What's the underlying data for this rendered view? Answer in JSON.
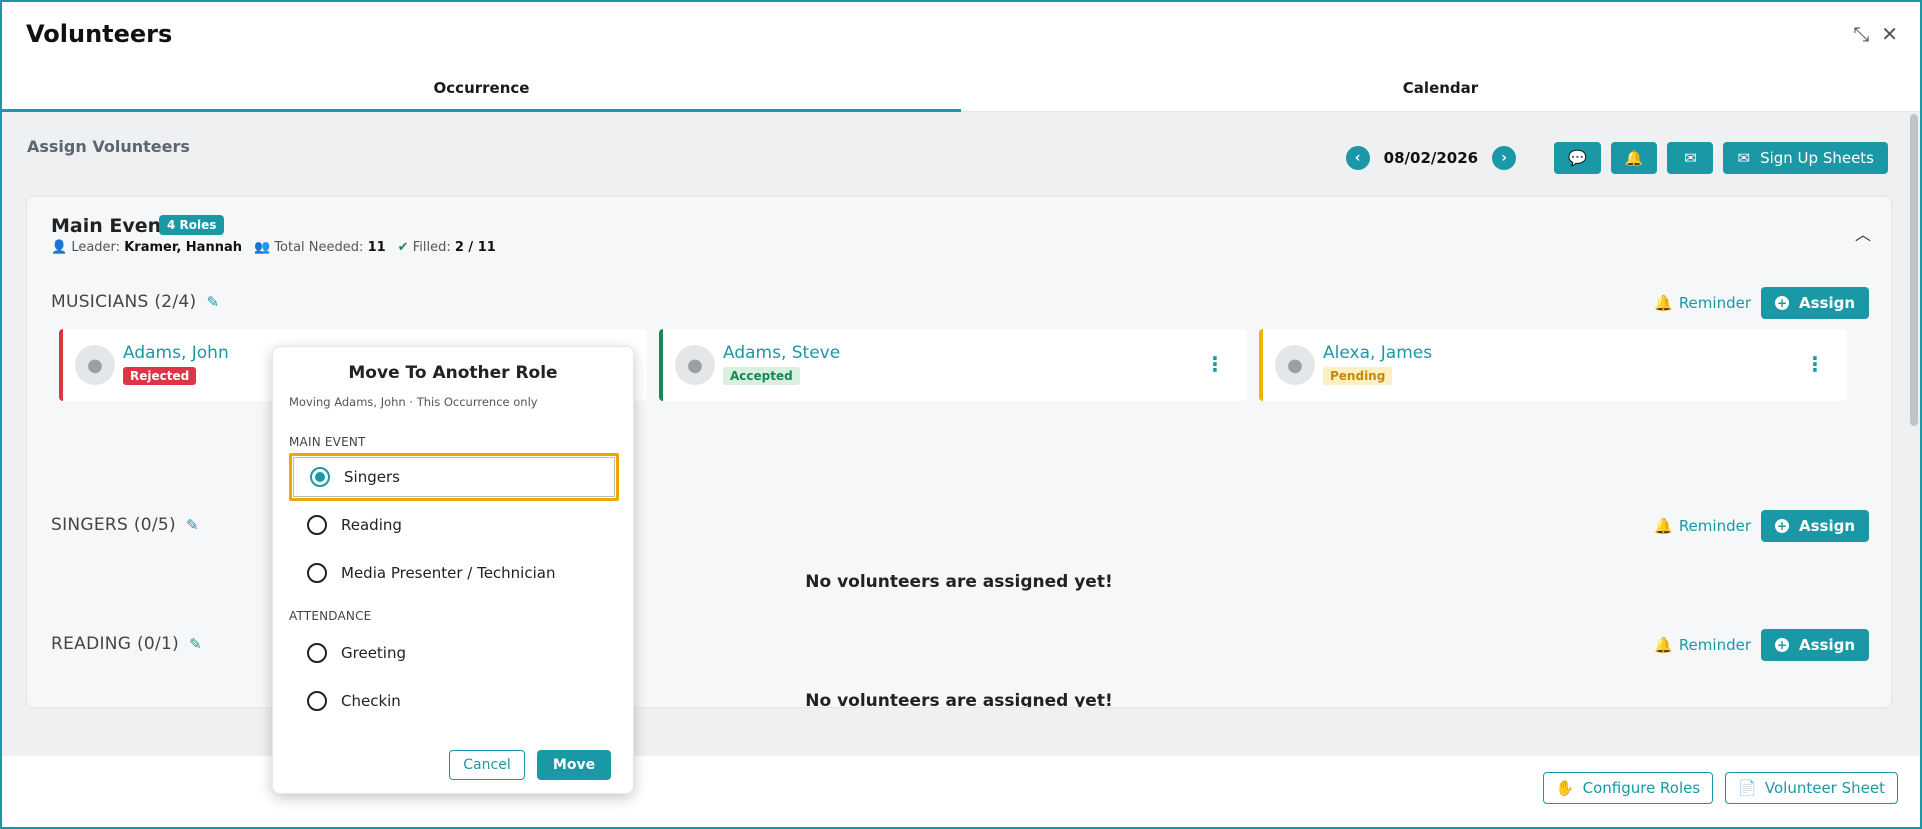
{
  "window": {
    "title": "Volunteers"
  },
  "tabs": [
    {
      "label": "Occurrence",
      "active": true
    },
    {
      "label": "Calendar",
      "active": false
    }
  ],
  "section": {
    "title": "Assign Volunteers"
  },
  "toolbar": {
    "date": "08/02/2026",
    "sign_up_label": "Sign Up Sheets"
  },
  "event": {
    "name": "Main Event",
    "roles_badge": "4 Roles",
    "leader_label": "Leader:",
    "leader": "Kramer, Hannah",
    "total_label": "Total Needed:",
    "total": "11",
    "filled_label": "Filled:",
    "filled": "2 / 11"
  },
  "roles": [
    {
      "heading": "MUSICIANS (2/4)",
      "reminder": "Reminder",
      "assign": "Assign",
      "volunteers": [
        {
          "name": "Adams, John",
          "status": "Rejected"
        },
        {
          "name": "Adams, Steve",
          "status": "Accepted"
        },
        {
          "name": "Alexa, James",
          "status": "Pending"
        }
      ]
    },
    {
      "heading": "SINGERS (0/5)",
      "reminder": "Reminder",
      "assign": "Assign",
      "empty": "No volunteers are assigned yet!"
    },
    {
      "heading": "READING (0/1)",
      "reminder": "Reminder",
      "assign": "Assign",
      "empty": "No volunteers are assigned yet!"
    }
  ],
  "footer": {
    "configure": "Configure Roles",
    "sheet": "Volunteer Sheet"
  },
  "popover": {
    "title": "Move To Another Role",
    "subtitle": "Moving Adams, John · This Occurrence only",
    "group1": "MAIN EVENT",
    "options1": [
      "Singers",
      "Reading",
      "Media Presenter / Technician"
    ],
    "group2": "ATTENDANCE",
    "options2": [
      "Greeting",
      "Checkin"
    ],
    "selected": "Singers",
    "cancel": "Cancel",
    "move": "Move"
  },
  "colors": {
    "accent": "#1a98a5",
    "rejected": "#dc3545",
    "accepted": "#198754",
    "pending": "#f0b400",
    "highlight": "#f0a500"
  },
  "icons": [
    "collapse-icon",
    "close-icon",
    "chevron-left-icon",
    "chevron-right-icon",
    "chat-icon",
    "bell-icon",
    "mail-icon",
    "envelope-open-icon",
    "edit-icon",
    "user-icon",
    "kebab-icon",
    "chevron-up-icon",
    "hand-icon",
    "file-icon"
  ]
}
